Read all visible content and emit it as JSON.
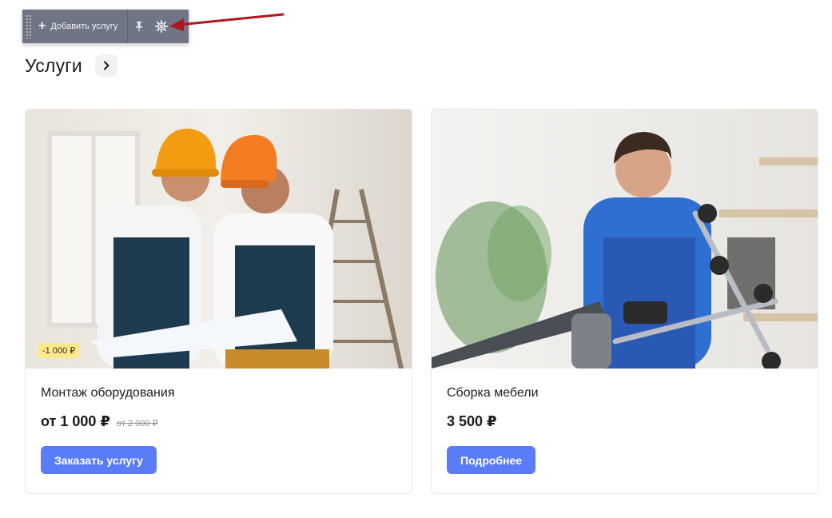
{
  "toolbar": {
    "add_service_label": "Добавить услугу",
    "plus_icon": "+",
    "pin_icon": "pin-icon",
    "settings_icon": "gear-icon",
    "background_color": "#6f7585",
    "annotation_arrow_color": "#b0161c"
  },
  "section": {
    "title": "Услуги",
    "arrow_icon": "chevron-right-icon"
  },
  "cards": [
    {
      "title": "Монтаж оборудования",
      "badge": "-1 000 ₽",
      "price": "от 1 000 ₽",
      "old_price": "от 2 000 ₽",
      "button_label": "Заказать услугу"
    },
    {
      "title": "Сборка мебели",
      "price": "3 500 ₽",
      "button_label": "Подробнее"
    }
  ],
  "colors": {
    "accent": "#5b7cf7",
    "badge": "#fbe88b"
  }
}
